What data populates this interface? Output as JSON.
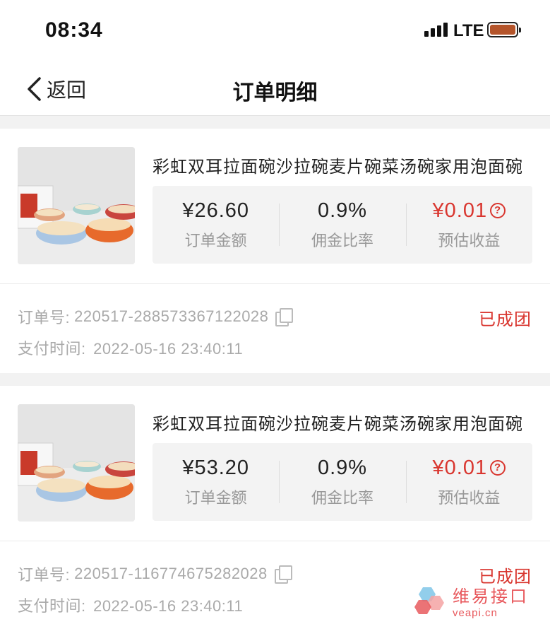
{
  "status_bar": {
    "time": "08:34",
    "network": "LTE"
  },
  "nav": {
    "back_label": "返回",
    "title": "订单明细"
  },
  "orders": [
    {
      "product_title": "彩虹双耳拉面碗沙拉碗麦片碗菜汤碗家用泡面碗",
      "amount": "¥26.60",
      "amount_label": "订单金额",
      "commission_rate": "0.9%",
      "commission_label": "佣金比率",
      "earning": "¥0.01",
      "earning_label": "预估收益",
      "order_no_label": "订单号:",
      "order_no": "220517-288573367122028",
      "pay_time_label": "支付时间:",
      "pay_time": "2022-05-16 23:40:11",
      "status": "已成团"
    },
    {
      "product_title": "彩虹双耳拉面碗沙拉碗麦片碗菜汤碗家用泡面碗",
      "amount": "¥53.20",
      "amount_label": "订单金额",
      "commission_rate": "0.9%",
      "commission_label": "佣金比率",
      "earning": "¥0.01",
      "earning_label": "预估收益",
      "order_no_label": "订单号:",
      "order_no": "220517-116774675282028",
      "pay_time_label": "支付时间:",
      "pay_time": "2022-05-16 23:40:11",
      "status": "已成团"
    }
  ],
  "watermark": {
    "name": "维易接口",
    "domain": "veapi.cn"
  },
  "colors": {
    "accent_red": "#d9362f",
    "battery": "#b4542a",
    "muted_text": "#aaaaaa",
    "panel_bg": "#f3f3f3"
  }
}
